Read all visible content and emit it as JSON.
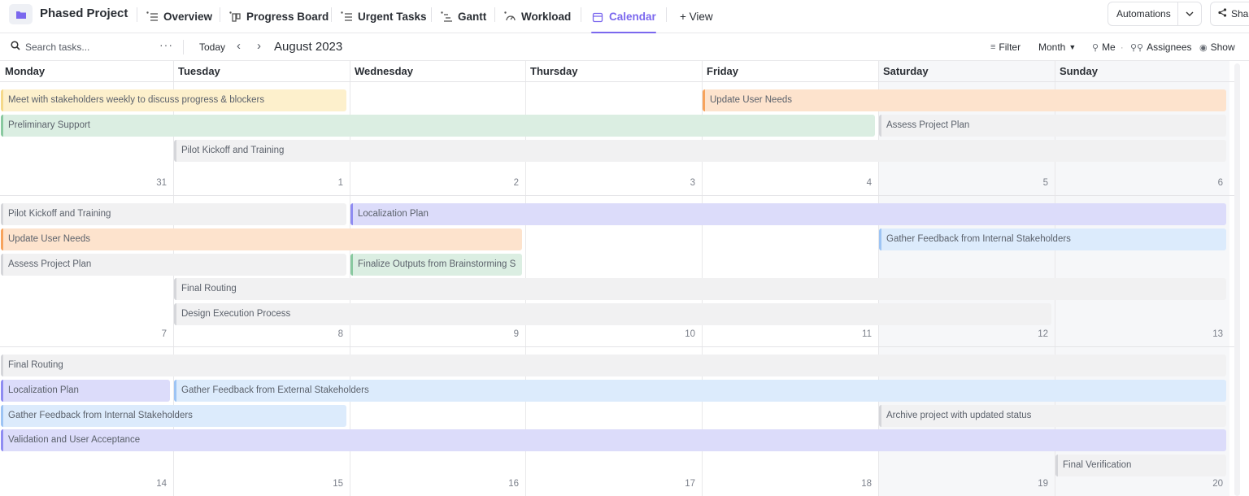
{
  "project": {
    "title": "Phased Project",
    "icon": "folder-icon"
  },
  "tabs": [
    {
      "label": "Overview",
      "icon": "list-icon",
      "active": false
    },
    {
      "label": "Progress Board",
      "icon": "board-icon",
      "active": false
    },
    {
      "label": "Urgent Tasks",
      "icon": "list-icon",
      "active": false
    },
    {
      "label": "Gantt",
      "icon": "gantt-icon",
      "active": false
    },
    {
      "label": "Workload",
      "icon": "gauge-icon",
      "active": false
    },
    {
      "label": "Calendar",
      "icon": "calendar-icon",
      "active": true
    }
  ],
  "add_view_label": "+ View",
  "header_actions": {
    "automations": "Automations",
    "share": "Shar"
  },
  "toolbar": {
    "search_placeholder": "Search tasks...",
    "more": "···",
    "today": "Today",
    "month": "August 2023",
    "filter": "Filter",
    "view_mode": "Month",
    "me": "Me",
    "assignees": "Assignees",
    "show": "Show"
  },
  "colors": {
    "accent": "#7b68ee"
  },
  "weekdays": [
    "Monday",
    "Tuesday",
    "Wednesday",
    "Thursday",
    "Friday",
    "Saturday",
    "Sunday"
  ],
  "weeks": [
    {
      "days": [
        "31",
        "1",
        "2",
        "3",
        "4",
        "5",
        "6"
      ],
      "events": [
        {
          "title": "Meet with stakeholders weekly to discuss progress & blockers",
          "start": 0,
          "span": 2,
          "lane": 0,
          "color": "yellow"
        },
        {
          "title": "Update User Needs",
          "start": 4,
          "span": 3,
          "lane": 0,
          "color": "orange"
        },
        {
          "title": "Preliminary Support",
          "start": 0,
          "span": 5,
          "lane": 1,
          "color": "green"
        },
        {
          "title": "Assess Project Plan",
          "start": 5,
          "span": 2,
          "lane": 1,
          "color": "gray"
        },
        {
          "title": "Pilot Kickoff and Training",
          "start": 1,
          "span": 6,
          "lane": 2,
          "color": "gray"
        }
      ]
    },
    {
      "days": [
        "7",
        "8",
        "9",
        "10",
        "11",
        "12",
        "13"
      ],
      "events": [
        {
          "title": "Pilot Kickoff and Training",
          "start": 0,
          "span": 2,
          "lane": 0,
          "color": "gray"
        },
        {
          "title": "Localization Plan",
          "start": 2,
          "span": 5,
          "lane": 0,
          "color": "purple"
        },
        {
          "title": "Update User Needs",
          "start": 0,
          "span": 3,
          "lane": 1,
          "color": "orange"
        },
        {
          "title": "Gather Feedback from Internal Stakeholders",
          "start": 5,
          "span": 2,
          "lane": 1,
          "color": "blue"
        },
        {
          "title": "Assess Project Plan",
          "start": 0,
          "span": 2,
          "lane": 2,
          "color": "gray"
        },
        {
          "title": "Finalize Outputs from Brainstorming S",
          "start": 2,
          "span": 1,
          "lane": 2,
          "color": "green"
        },
        {
          "title": "Final Routing",
          "start": 1,
          "span": 6,
          "lane": 3,
          "color": "gray"
        },
        {
          "title": "Design Execution Process",
          "start": 1,
          "span": 5,
          "lane": 4,
          "color": "gray"
        }
      ]
    },
    {
      "days": [
        "14",
        "15",
        "16",
        "17",
        "18",
        "19",
        "20"
      ],
      "events": [
        {
          "title": "Final Routing",
          "start": 0,
          "span": 7,
          "lane": 0,
          "color": "gray"
        },
        {
          "title": "Localization Plan",
          "start": 0,
          "span": 1,
          "lane": 1,
          "color": "purple"
        },
        {
          "title": "Gather Feedback from External Stakeholders",
          "start": 1,
          "span": 6,
          "lane": 1,
          "color": "blue"
        },
        {
          "title": "Gather Feedback from Internal Stakeholders",
          "start": 0,
          "span": 2,
          "lane": 2,
          "color": "blue"
        },
        {
          "title": "Archive project with updated status",
          "start": 5,
          "span": 2,
          "lane": 2,
          "color": "gray"
        },
        {
          "title": "Validation and User Acceptance",
          "start": 0,
          "span": 7,
          "lane": 3,
          "color": "purple"
        },
        {
          "title": "Final Verification",
          "start": 6,
          "span": 1,
          "lane": 4,
          "color": "gray"
        }
      ]
    }
  ]
}
